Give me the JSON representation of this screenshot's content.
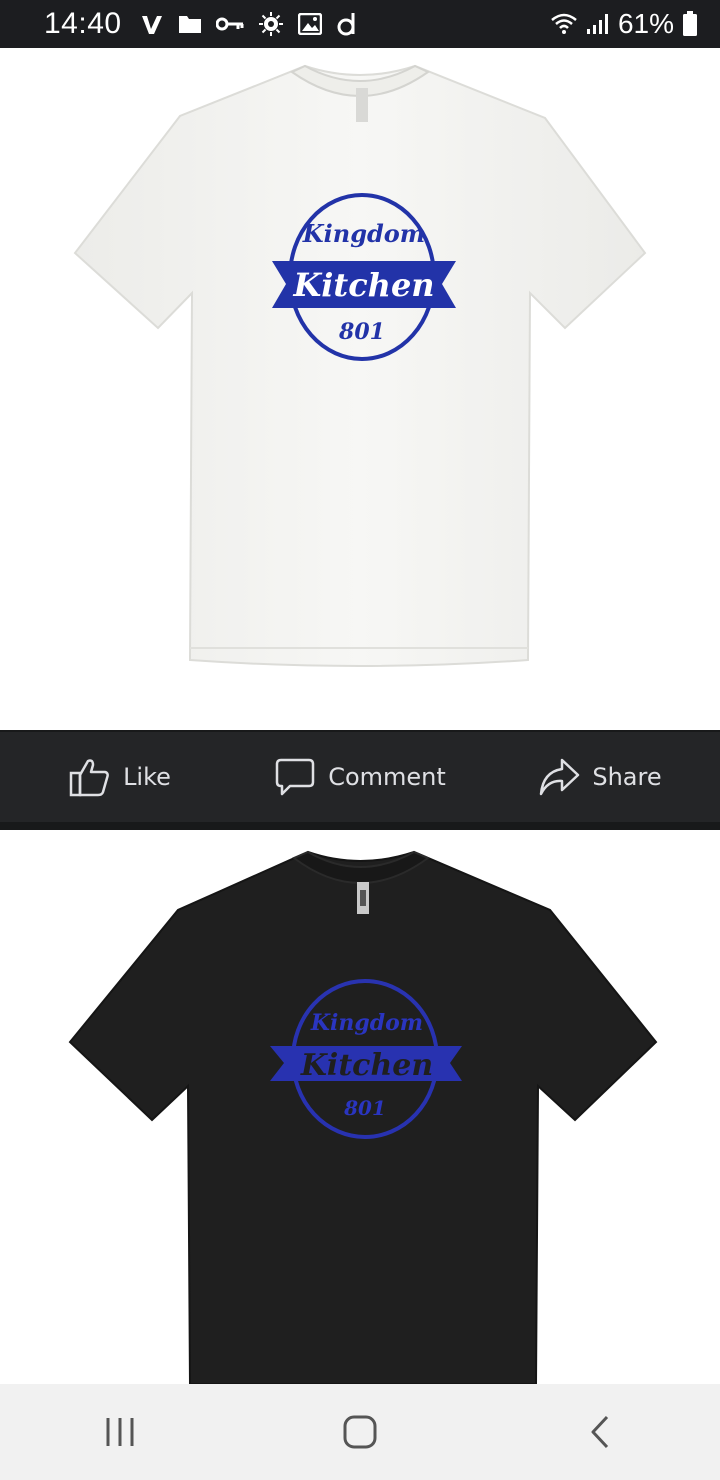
{
  "status_bar": {
    "time": "14:40",
    "battery": "61%",
    "left_icons": [
      "vimeo-icon",
      "folder-icon",
      "key-icon",
      "settings-icon",
      "image-icon",
      "app-d-icon"
    ],
    "right_icons": [
      "wifi-icon",
      "signal-icon",
      "battery-icon"
    ]
  },
  "post": {
    "shirt_design": {
      "line1": "Kingdom",
      "line2": "Kitchen",
      "line3": "801",
      "color": "#2233a8"
    },
    "actions": {
      "like": "Like",
      "comment": "Comment",
      "share": "Share"
    }
  },
  "nav": {
    "icons": [
      "recents-icon",
      "home-icon",
      "back-icon"
    ]
  },
  "colors": {
    "status_bar_bg": "#1c1d20",
    "action_bar_bg": "#242527",
    "nav_bar_bg": "#f1f1f1",
    "logo_blue": "#2233a8"
  }
}
